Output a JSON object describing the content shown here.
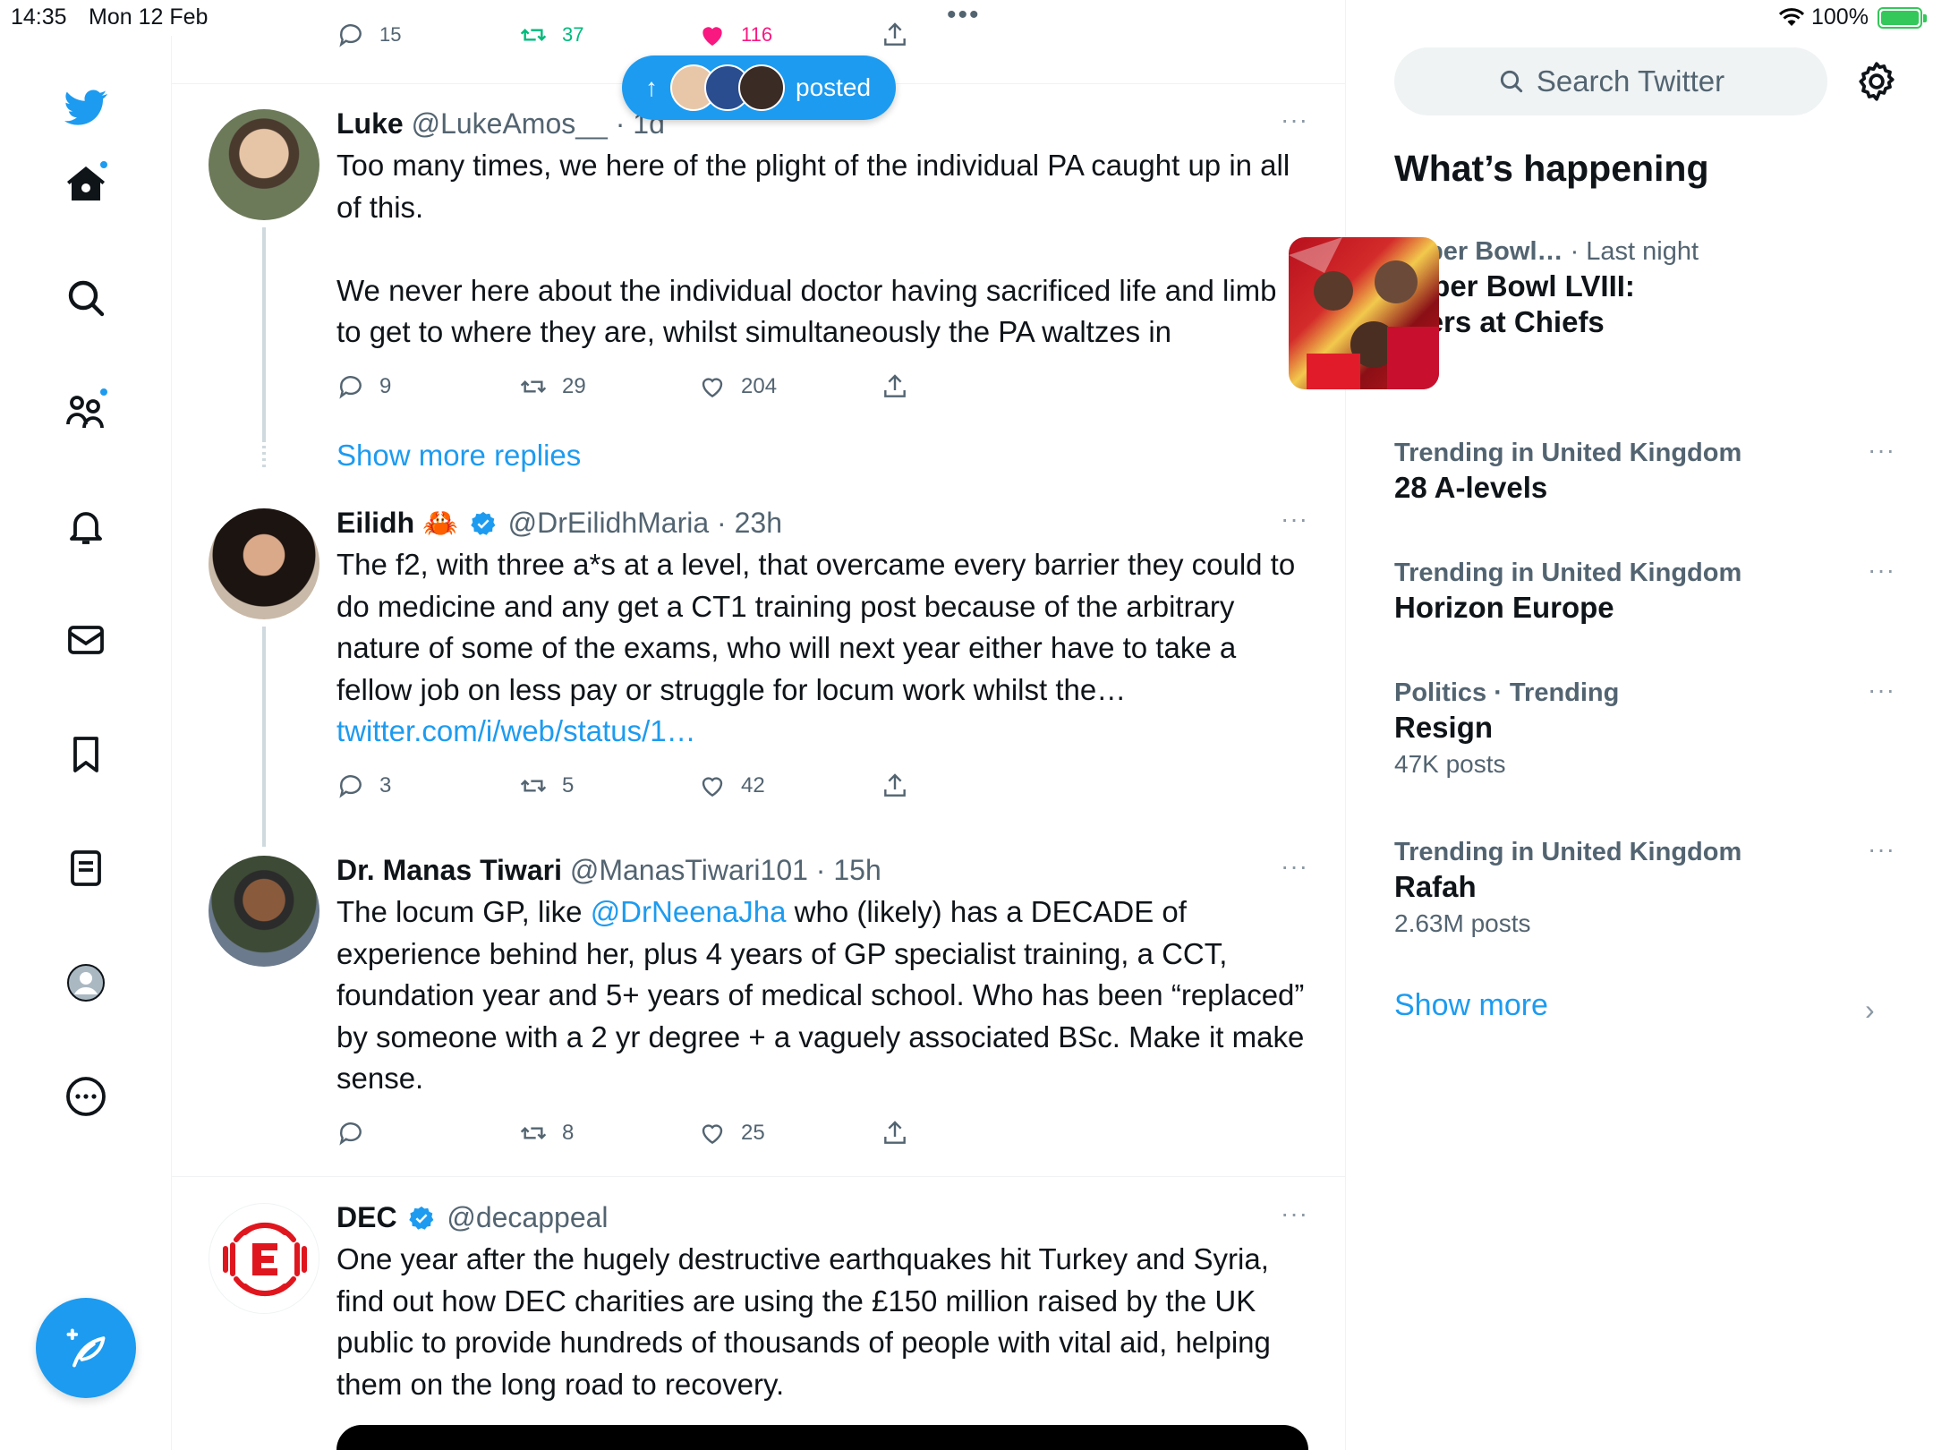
{
  "status_bar": {
    "time": "14:35",
    "date": "Mon 12 Feb",
    "battery": "100%"
  },
  "previous_tweet_actions": {
    "replies": "15",
    "retweets": "37",
    "likes": "116"
  },
  "posted_pill": {
    "label": "posted"
  },
  "tweets": [
    {
      "name": "Luke",
      "handle": "@LukeAmos__",
      "time": "· 1d",
      "text": "Too many times, we here of the plight of the individual PA caught up in all of this.\n\nWe never here about the individual doctor having sacrificed life and limb to get to where they are, whilst simultaneously the PA waltzes in",
      "replies": "9",
      "retweets": "29",
      "likes": "204"
    },
    {
      "name": "Eilidh",
      "emoji": "🦀",
      "handle": "@DrEilidhMaria",
      "time": "· 23h",
      "text": "The f2, with three a*s at a level, that overcame every barrier they could to do medicine and any get a CT1 training post because of the arbitrary nature of some of the exams, who will next year either have to take a fellow job on less pay or struggle for locum work whilst the…",
      "link": "twitter.com/i/web/status/1…",
      "replies": "3",
      "retweets": "5",
      "likes": "42"
    },
    {
      "name": "Dr. Manas Tiwari",
      "handle": "@ManasTiwari101",
      "time": "· 15h",
      "text_before": "The locum GP, like ",
      "mention": "@DrNeenaJha",
      "text_after": " who (likely) has a DECADE of experience behind her, plus 4 years of GP specialist training, a CCT, foundation year and 5+ years of medical school. Who has been “replaced” by someone with a 2 yr degree + a vaguely associated BSc. Make it make sense.",
      "replies": "",
      "retweets": "8",
      "likes": "25"
    },
    {
      "name": "DEC",
      "handle": "@decappeal",
      "text": "One year after the hugely destructive earthquakes hit Turkey and Syria, find out how DEC charities are using the £150 million raised by the UK public to provide hundreds of thousands of people with vital aid, helping them on the long road to recovery."
    }
  ],
  "show_more_replies": "Show more replies",
  "right": {
    "search_placeholder": "Search Twitter",
    "whats_happening": "What’s happening",
    "trends": [
      {
        "meta": "Super Bowl…",
        "meta2": "· Last night",
        "title_line1": "Super Bowl LVIII:",
        "title_line2": "49ers at Chiefs"
      },
      {
        "meta": "Trending in United Kingdom",
        "title": "28 A-levels"
      },
      {
        "meta": "Trending in United Kingdom",
        "title": "Horizon Europe"
      },
      {
        "meta": "Politics · Trending",
        "title": "Resign",
        "sub": "47K posts"
      },
      {
        "meta": "Trending in United Kingdom",
        "title": "Rafah",
        "sub": "2.63M posts"
      }
    ],
    "show_more": "Show more"
  },
  "more_label": "···",
  "colors": {
    "accent": "#1d9bf0",
    "text": "#0f1419",
    "secondary": "#536471"
  }
}
